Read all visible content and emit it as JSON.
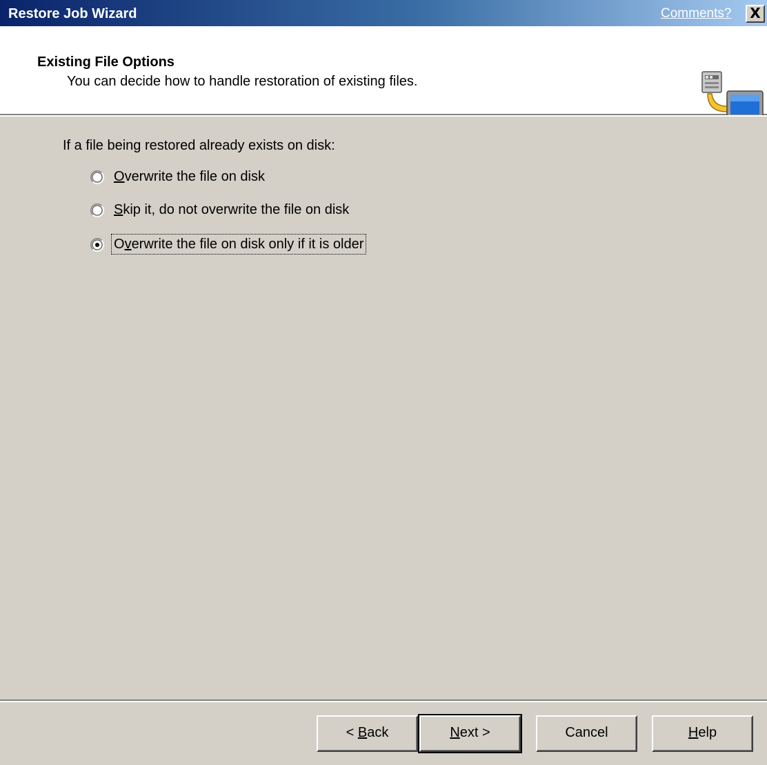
{
  "window": {
    "title": "Restore Job Wizard",
    "comments_link": "Comments?",
    "close_symbol": "X"
  },
  "header": {
    "title": "Existing File Options",
    "subtitle": "You can decide how to handle restoration of existing files.",
    "icon": "restore-to-computer-icon"
  },
  "content": {
    "question": "If a file being restored already exists on disk:",
    "options": [
      {
        "pre": "",
        "mnemonic": "O",
        "post": "verwrite the file on disk",
        "selected": false
      },
      {
        "pre": "",
        "mnemonic": "S",
        "post": "kip it, do not overwrite the file on disk",
        "selected": false
      },
      {
        "pre": "O",
        "mnemonic": "v",
        "post": "erwrite the file on disk only if it is older",
        "selected": true
      }
    ]
  },
  "buttons": {
    "back": {
      "pre": "< ",
      "mnemonic": "B",
      "post": "ack"
    },
    "next": {
      "pre": "",
      "mnemonic": "N",
      "post": "ext >"
    },
    "cancel": {
      "label": "Cancel"
    },
    "help": {
      "pre": "",
      "mnemonic": "H",
      "post": "elp"
    }
  },
  "colors": {
    "titlebar_start": "#0a246a",
    "titlebar_end": "#a6caf0",
    "dialog_face": "#d4d0c8",
    "header_bg": "#ffffff"
  }
}
